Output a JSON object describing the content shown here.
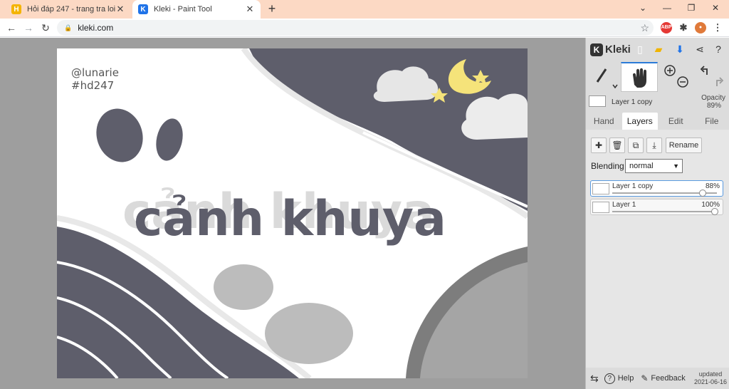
{
  "browser": {
    "tabs": [
      {
        "title": "Hỏi đáp 247 - trang tra loi",
        "favicon": "hd247-icon",
        "color": "#f4b400",
        "active": false
      },
      {
        "title": "Kleki - Paint Tool",
        "favicon": "kleki-icon",
        "color": "#1f73e8",
        "active": true
      }
    ],
    "new_tab_label": "+",
    "address": "kleki.com",
    "extensions": [
      {
        "label": "ABP",
        "color": "#e53935"
      }
    ]
  },
  "canvas": {
    "handle_line1": "@lunarie",
    "handle_line2": "#hd247",
    "headline": "cảnh khuya",
    "colors": {
      "dark": "#5e5e6b",
      "light_gray": "#bcbcbc",
      "mid_gray": "#a5a5a5",
      "moon": "#f5e37a",
      "white": "#ffffff"
    }
  },
  "panel": {
    "app_name": "Kleki",
    "tool_icons": [
      "brush-icon",
      "hand-icon",
      "zoom-in-icon",
      "zoom-out-icon",
      "undo-icon",
      "redo-icon"
    ],
    "current_layer_name": "Layer 1 copy",
    "opacity_label": "Opacity",
    "opacity_value": "89%",
    "tabs": [
      "Hand",
      "Layers",
      "Edit",
      "File"
    ],
    "active_tab": "Layers",
    "rename_label": "Rename",
    "blending_label": "Blending",
    "blending_value": "normal",
    "layers": [
      {
        "name": "Layer 1 copy",
        "opacity": "88%",
        "opacity_fraction": 0.88,
        "selected": true
      },
      {
        "name": "Layer 1",
        "opacity": "100%",
        "opacity_fraction": 1.0,
        "selected": false
      }
    ],
    "help_label": "Help",
    "feedback_label": "Feedback",
    "updated_label": "updated",
    "updated_date": "2021-06-16"
  }
}
